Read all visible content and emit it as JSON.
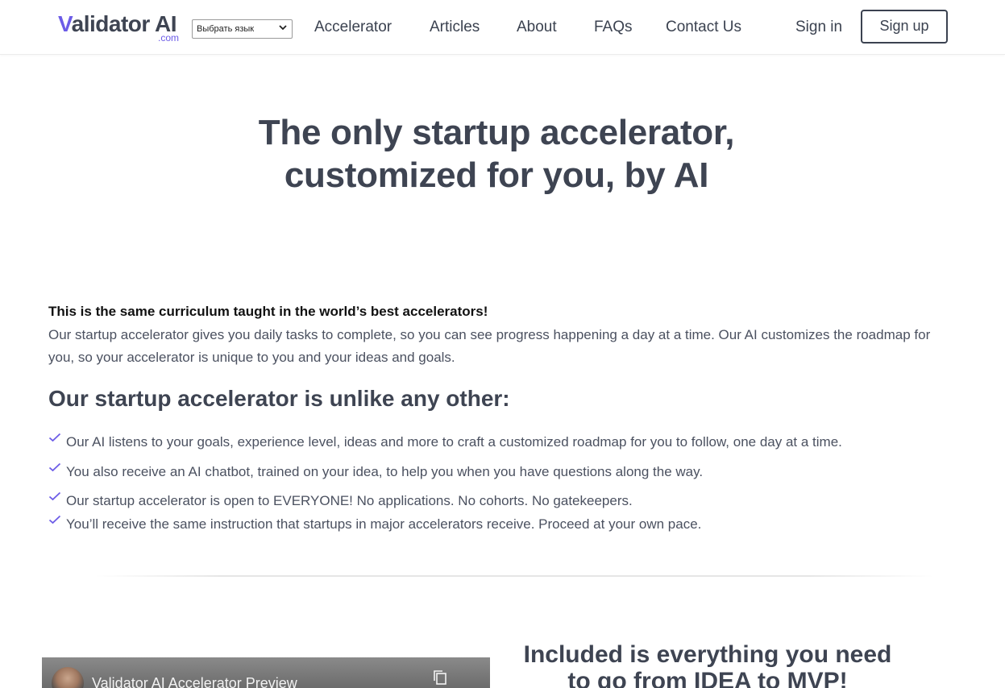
{
  "header": {
    "logo": {
      "main_prefix": "V",
      "main_rest": "alidator AI",
      "suffix": ".com"
    },
    "language_select": {
      "value": "Выбрать язык"
    },
    "nav": [
      "Accelerator",
      "Articles",
      "About",
      "FAQs",
      "Contact Us"
    ],
    "sign_in": "Sign in",
    "sign_up": "Sign up"
  },
  "hero": {
    "title_line1": "The only startup accelerator,",
    "title_line2": "customized for you, by AI"
  },
  "intro": {
    "bold": "This is the same curriculum taught in the world’s best accelerators!",
    "paragraph": "Our startup accelerator gives you daily tasks to complete, so you can see progress happening a day at a time. Our AI customizes the roadmap for you, so your accelerator is unique to you and your ideas and goals."
  },
  "features": {
    "heading": "Our startup accelerator is unlike any other:",
    "items": [
      "Our AI listens to your goals, experience level, ideas and more to craft a customized roadmap for you to follow, one day at a time.",
      "You also receive an AI chatbot, trained on your idea, to help you when you have questions along the way.",
      "Our startup accelerator is open to EVERYONE! No applications. No cohorts. No gatekeepers.",
      "You’ll receive the same instruction that startups in major accelerators receive. Proceed at your own pace."
    ]
  },
  "video": {
    "title": "Validator AI Accelerator Preview"
  },
  "included": {
    "line1": "Included is everything you need",
    "line2": "to go from IDEA to MVP!"
  },
  "colors": {
    "brand_purple": "#6c5ce7",
    "heading_text": "#3e4452",
    "body_text": "#4b5160"
  },
  "icons": [
    "check-icon",
    "chevron-down-icon",
    "copy-link-icon",
    "channel-avatar"
  ]
}
